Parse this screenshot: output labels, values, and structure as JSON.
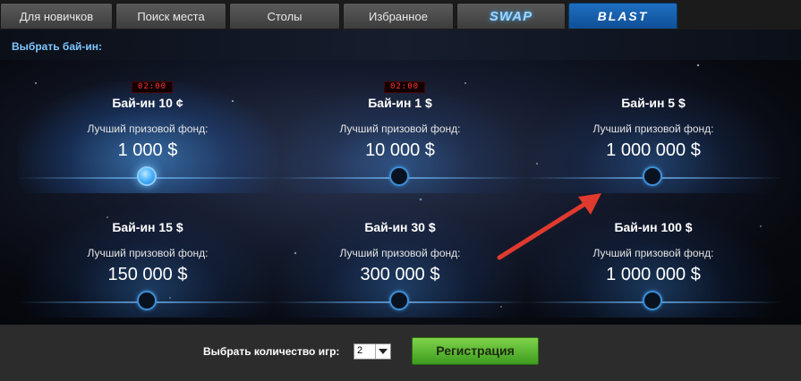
{
  "tabs": [
    {
      "label": "Для новичков"
    },
    {
      "label": "Поиск места"
    },
    {
      "label": "Столы"
    },
    {
      "label": "Избранное"
    },
    {
      "label": "SWAP"
    },
    {
      "label": "BLAST"
    }
  ],
  "active_tab": "BLAST",
  "panel": {
    "title": "Выбрать бай-ин:"
  },
  "buyins": [
    {
      "label": "Бай-ин 10 ¢",
      "pool_label": "Лучший призовой фонд:",
      "pool": "1 000 $",
      "timer": "02:00",
      "selected": true
    },
    {
      "label": "Бай-ин 1 $",
      "pool_label": "Лучший призовой фонд:",
      "pool": "10 000 $",
      "timer": "02:00",
      "selected": false
    },
    {
      "label": "Бай-ин 5 $",
      "pool_label": "Лучший призовой фонд:",
      "pool": "1 000 000 $",
      "timer": "",
      "selected": false
    },
    {
      "label": "Бай-ин 15 $",
      "pool_label": "Лучший призовой фонд:",
      "pool": "150 000 $",
      "timer": "",
      "selected": false
    },
    {
      "label": "Бай-ин 30 $",
      "pool_label": "Лучший призовой фонд:",
      "pool": "300 000 $",
      "timer": "",
      "selected": false
    },
    {
      "label": "Бай-ин 100 $",
      "pool_label": "Лучший призовой фонд:",
      "pool": "1 000 000 $",
      "timer": "",
      "selected": false
    }
  ],
  "footer": {
    "games_label": "Выбрать количество игр:",
    "games_value": "2",
    "register_label": "Регистрация"
  },
  "colors": {
    "accent": "#1e6fc2",
    "register": "#5cb832",
    "arrow": "#e03a2e",
    "title": "#7fc8ff"
  }
}
